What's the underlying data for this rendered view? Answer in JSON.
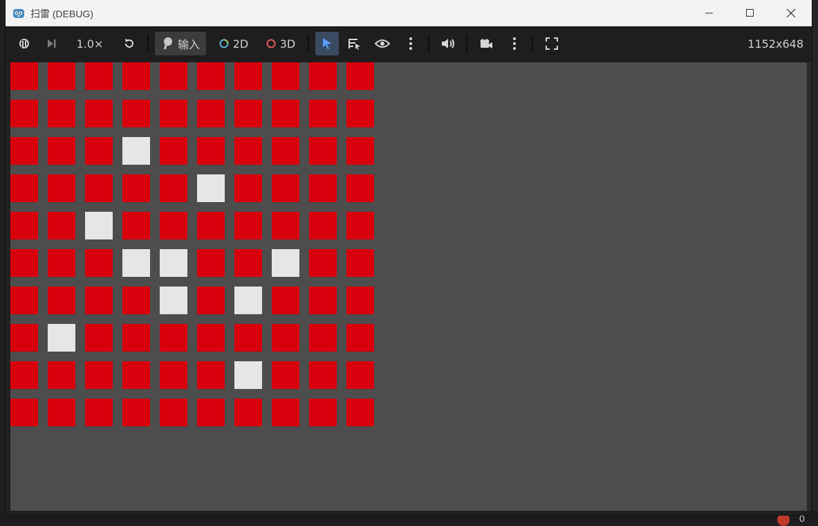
{
  "window": {
    "title": "扫雷 (DEBUG)"
  },
  "toolbar": {
    "speed": "1.0×",
    "input_label": "输入",
    "mode_2d": "2D",
    "mode_3d": "3D",
    "resolution": "1152x648"
  },
  "background": {
    "error_count": "0"
  },
  "colors": {
    "hidden_cell": "#d8000c",
    "revealed_cell": "#e6e6e6",
    "viewport_bg": "#4d4d4d",
    "toolbar_bg": "#1e1e1e"
  },
  "board": {
    "rows": 10,
    "cols": 10,
    "cells": [
      [
        "hidden",
        "hidden",
        "hidden",
        "hidden",
        "hidden",
        "hidden",
        "hidden",
        "hidden",
        "hidden",
        "hidden"
      ],
      [
        "hidden",
        "hidden",
        "hidden",
        "hidden",
        "hidden",
        "hidden",
        "hidden",
        "hidden",
        "hidden",
        "hidden"
      ],
      [
        "hidden",
        "hidden",
        "hidden",
        "revealed",
        "hidden",
        "hidden",
        "hidden",
        "hidden",
        "hidden",
        "hidden"
      ],
      [
        "hidden",
        "hidden",
        "hidden",
        "hidden",
        "hidden",
        "revealed",
        "hidden",
        "hidden",
        "hidden",
        "hidden"
      ],
      [
        "hidden",
        "hidden",
        "revealed",
        "hidden",
        "hidden",
        "hidden",
        "hidden",
        "hidden",
        "hidden",
        "hidden"
      ],
      [
        "hidden",
        "hidden",
        "hidden",
        "revealed",
        "revealed",
        "hidden",
        "hidden",
        "revealed",
        "hidden",
        "hidden"
      ],
      [
        "hidden",
        "hidden",
        "hidden",
        "hidden",
        "revealed",
        "hidden",
        "revealed",
        "hidden",
        "hidden",
        "hidden"
      ],
      [
        "hidden",
        "revealed",
        "hidden",
        "hidden",
        "hidden",
        "hidden",
        "hidden",
        "hidden",
        "hidden",
        "hidden"
      ],
      [
        "hidden",
        "hidden",
        "hidden",
        "hidden",
        "hidden",
        "hidden",
        "revealed",
        "hidden",
        "hidden",
        "hidden"
      ],
      [
        "hidden",
        "hidden",
        "hidden",
        "hidden",
        "hidden",
        "hidden",
        "hidden",
        "hidden",
        "hidden",
        "hidden"
      ]
    ]
  }
}
